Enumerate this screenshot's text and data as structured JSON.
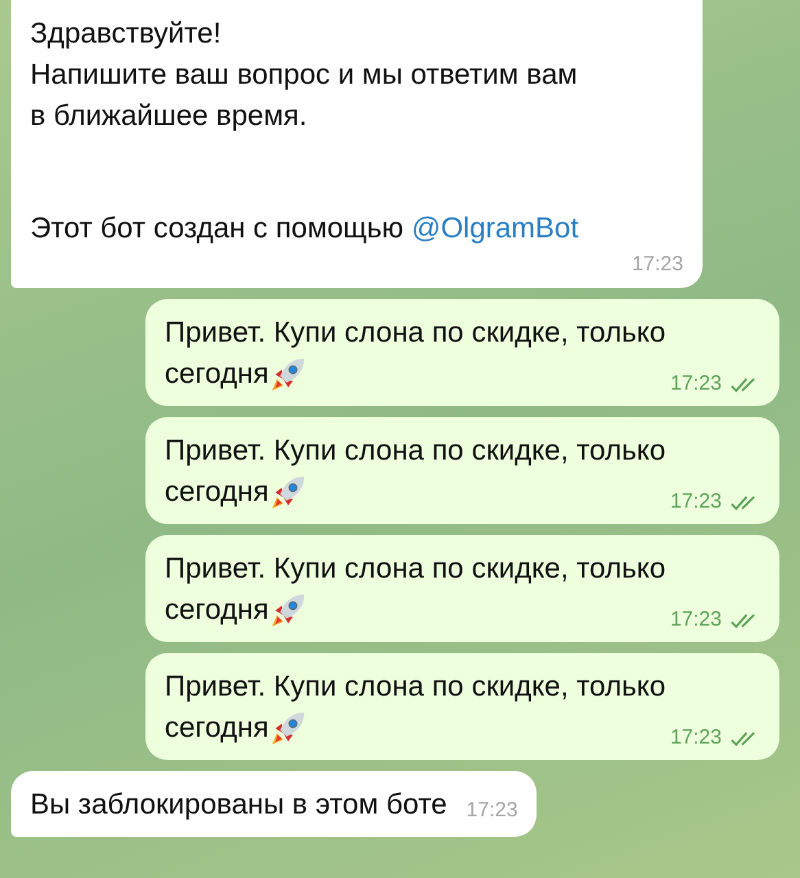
{
  "messages": [
    {
      "kind": "incoming",
      "text": "Здравствуйте!\nНапишите ваш вопрос и мы ответим вам\nв ближайшее время.",
      "footer": "Этот бот создан с помощью",
      "link": "@OlgramBot",
      "time": "17:23"
    },
    {
      "kind": "outgoing",
      "lines": [
        "Привет. Купи слона по скидке, только",
        "сегодня"
      ],
      "rocket": true,
      "time": "17:23",
      "read": true
    },
    {
      "kind": "outgoing",
      "lines": [
        "Привет. Купи слона по скидке, только",
        "сегодня"
      ],
      "rocket": true,
      "time": "17:23",
      "read": true
    },
    {
      "kind": "outgoing",
      "lines": [
        "Привет. Купи слона по скидке, только",
        "сегодня"
      ],
      "rocket": true,
      "time": "17:23",
      "read": true
    },
    {
      "kind": "outgoing",
      "lines": [
        "Привет. Купи слона по скидке, только",
        "сегодня"
      ],
      "rocket": true,
      "time": "17:23",
      "read": true
    },
    {
      "kind": "incoming",
      "text": "Вы заблокированы в этом боте",
      "time": "17:23"
    }
  ]
}
